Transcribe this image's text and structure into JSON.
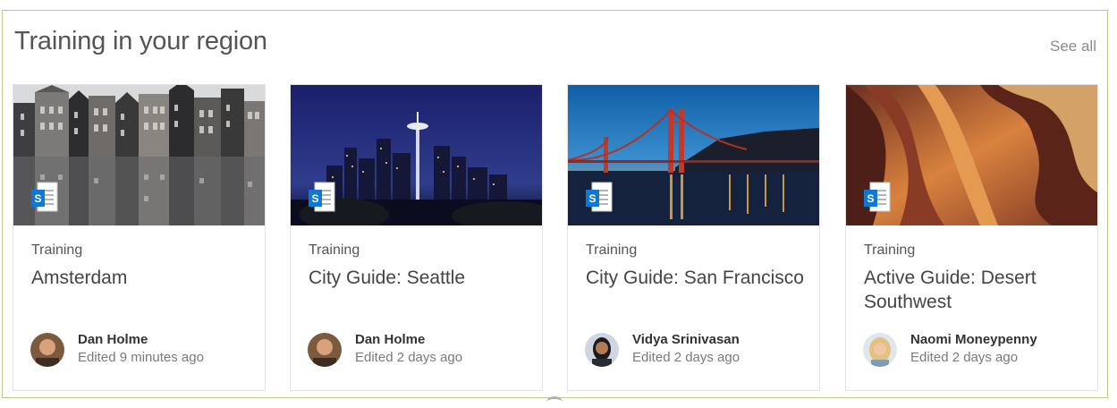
{
  "section": {
    "title": "Training in your region",
    "see_all": "See all"
  },
  "cards": [
    {
      "category": "Training",
      "title": "Amsterdam",
      "author": "Dan Holme",
      "edited": "Edited 9 minutes ago",
      "image": "amsterdam-canal-houses",
      "doc_icon": "sharepoint-page-icon"
    },
    {
      "category": "Training",
      "title": "City Guide: Seattle",
      "author": "Dan Holme",
      "edited": "Edited 2 days ago",
      "image": "seattle-skyline-night",
      "doc_icon": "sharepoint-page-icon"
    },
    {
      "category": "Training",
      "title": "City Guide: San Francisco",
      "author": "Vidya Srinivasan",
      "edited": "Edited 2 days ago",
      "image": "golden-gate-bridge-sunset",
      "doc_icon": "sharepoint-page-icon"
    },
    {
      "category": "Training",
      "title": "Active Guide: Desert Southwest",
      "author": "Naomi Moneypenny",
      "edited": "Edited 2 days ago",
      "image": "antelope-canyon",
      "doc_icon": "sharepoint-page-icon"
    }
  ],
  "colors": {
    "border": "#b9c98a",
    "sharepoint_blue": "#0f78d4"
  }
}
